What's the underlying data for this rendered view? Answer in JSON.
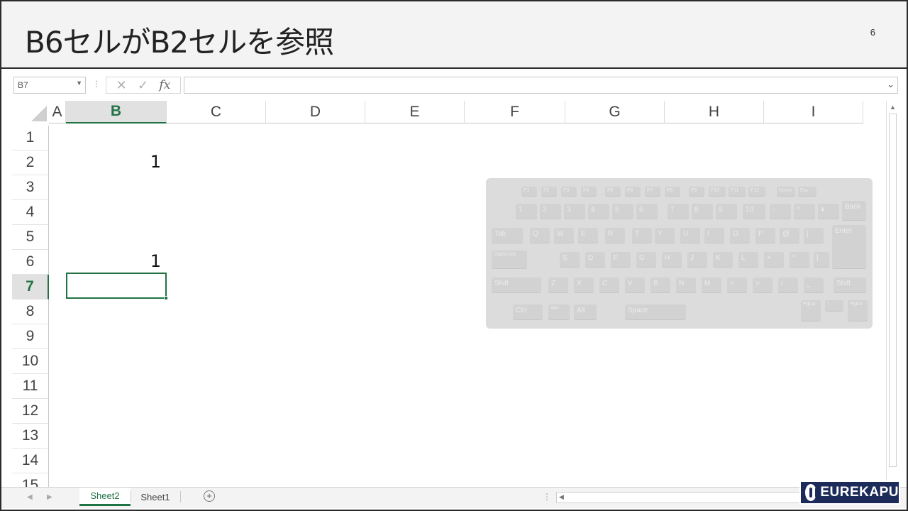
{
  "slide": {
    "title": "B6セルがB2セルを参照",
    "page_number": "6"
  },
  "formula_bar": {
    "name_box": "B7",
    "cancel_icon": "✕",
    "enter_icon": "✓",
    "fx_label": "fx",
    "formula": ""
  },
  "grid": {
    "columns": [
      "A",
      "B",
      "C",
      "D",
      "E",
      "F",
      "G",
      "H",
      "I"
    ],
    "rows": [
      "1",
      "2",
      "3",
      "4",
      "5",
      "6",
      "7",
      "8",
      "9",
      "10",
      "11",
      "12",
      "13",
      "14",
      "15"
    ],
    "active_column": "B",
    "active_row": "7",
    "cells": {
      "B2": "1",
      "B6": "1"
    }
  },
  "keyboard": {
    "fn_row": [
      "F1",
      "F2",
      "F3",
      "F4",
      "F5",
      "F6",
      "F7",
      "F8",
      "F9",
      "F10",
      "F11",
      "F12",
      "Home",
      "Esc"
    ],
    "num_row": [
      "1",
      "2",
      "3",
      "4",
      "5",
      "6",
      "7",
      "8",
      "9",
      "10",
      "-",
      "^",
      "¥",
      "Back"
    ],
    "top_row": [
      "Tab",
      "Q",
      "W",
      "E",
      "R",
      "T",
      "Y",
      "U",
      "I",
      "O",
      "P",
      "@",
      "[",
      "Enter"
    ],
    "home_row": [
      "CapsLock",
      "S",
      "D",
      "F",
      "G",
      "H",
      "J",
      "K",
      "L",
      "+",
      "*",
      "]"
    ],
    "shift_row": [
      "Shift",
      "Z",
      "X",
      "C",
      "V",
      "B",
      "N",
      "M",
      "<",
      ">",
      "/",
      "_",
      "Shift"
    ],
    "bottom_row": [
      "Ctrl",
      "Win",
      "Alt",
      "Space",
      "PgUp",
      "↑",
      "PgDn"
    ]
  },
  "sheets": {
    "tabs": [
      "Sheet2",
      "Sheet1"
    ],
    "active": "Sheet2"
  },
  "logo": {
    "text": "EUREKAPU"
  },
  "colors": {
    "excel_green": "#217346",
    "logo_bg": "#1c2b5a",
    "title_bg": "#f3f3f3"
  }
}
